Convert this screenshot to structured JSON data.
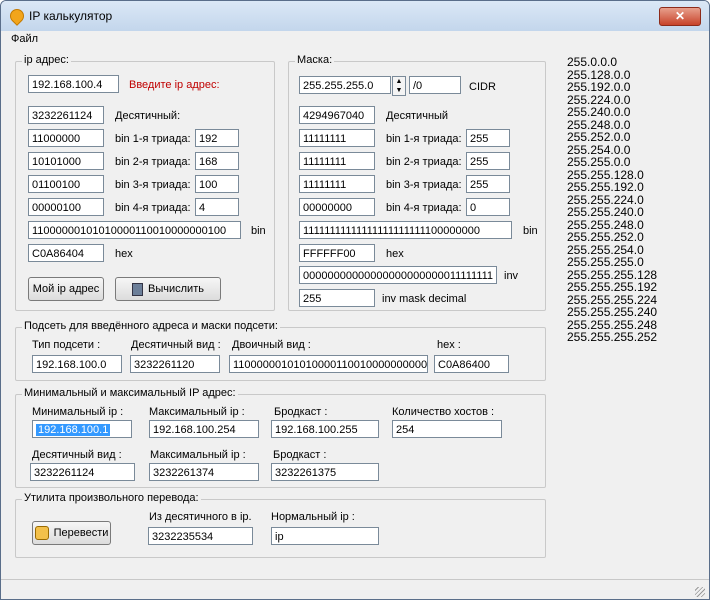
{
  "window": {
    "title": "IP калькулятор",
    "close": "✕"
  },
  "menu": {
    "file": "Файл"
  },
  "ip_group": {
    "label": "ip адрес:",
    "ip": "192.168.100.4",
    "hint": "Введите ip адрес:",
    "decimal": "3232261124",
    "decimal_label": "Десятичный:",
    "bin1": "11000000",
    "bin1_label": "bin 1-я триада:",
    "tri1": "192",
    "bin2": "10101000",
    "bin2_label": "bin 2-я триада:",
    "tri2": "168",
    "bin3": "01100100",
    "bin3_label": "bin 3-я триада:",
    "tri3": "100",
    "bin4": "00000100",
    "bin4_label": "bin 4-я триада:",
    "tri4": "4",
    "bin_full": "11000000101010000110010000000100",
    "bin_label": "bin",
    "hex": "C0A86404",
    "hex_label": "hex",
    "my_ip_button": "Мой ip адрес",
    "calc_button": "Вычислить"
  },
  "mask_group": {
    "label": "Маска:",
    "mask": "255.255.255.0",
    "cidr_value": "/0",
    "cidr_label": "CIDR",
    "decimal": "4294967040",
    "decimal_label": "Десятичный",
    "bin1": "11111111",
    "bin1_label": "bin 1-я триада:",
    "tri1": "255",
    "bin2": "11111111",
    "bin2_label": "bin 2-я триада:",
    "tri2": "255",
    "bin3": "11111111",
    "bin3_label": "bin 3-я триада:",
    "tri3": "255",
    "bin4": "00000000",
    "bin4_label": "bin 4-я триада:",
    "tri4": "0",
    "bin_full": "11111111111111111111111100000000",
    "bin_label": "bin",
    "hex": "FFFFFF00",
    "hex_label": "hex",
    "inv": "00000000000000000000000011111111",
    "inv_label": "inv",
    "inv_decimal": "255",
    "inv_decimal_label": "inv mask decimal"
  },
  "subnet_group": {
    "label": "Подсеть для введённого адреса и маски подсети:",
    "type_label": "Тип подсети :",
    "type_value": "192.168.100.0",
    "decimal_label": "Десятичный вид :",
    "decimal_value": "3232261120",
    "binary_label": "Двоичный вид :",
    "binary_value": "11000000101010000110010000000000",
    "hex_label": "hex :",
    "hex_value": "C0A86400"
  },
  "minmax_group": {
    "label": "Минимальный и максимальный IP адрес:",
    "min_label": "Минимальный  ip :",
    "min_value": "192.168.100.1",
    "max_label": "Максимальный ip :",
    "max_value": "192.168.100.254",
    "broadcast_label": "Бродкаст :",
    "broadcast_value": "192.168.100.255",
    "hosts_label": "Количество хостов :",
    "hosts_value": "254",
    "min_dec_label": "Десятичный вид :",
    "min_dec_value": "3232261124",
    "max_dec_label": "Максимальный ip :",
    "max_dec_value": "3232261374",
    "broadcast_dec_label": "Бродкаст :",
    "broadcast_dec_value": "3232261375"
  },
  "convert_group": {
    "label": "Утилита произвольного перевода:",
    "button": "Перевести",
    "from_dec_label": "Из десятичного в ip.",
    "from_dec_value": "3232235534",
    "normal_label": "Нормальный ip :",
    "normal_value": "ip"
  },
  "mask_list": [
    "255.0.0.0",
    "255.128.0.0",
    "255.192.0.0",
    "255.224.0.0",
    "255.240.0.0",
    "255.248.0.0",
    "255.252.0.0",
    "255.254.0.0",
    "255.255.0.0",
    "255.255.128.0",
    "255.255.192.0",
    "255.255.224.0",
    "255.255.240.0",
    "255.255.248.0",
    "255.255.252.0",
    "255.255.254.0",
    "255.255.255.0",
    "255.255.255.128",
    "255.255.255.192",
    "255.255.255.224",
    "255.255.255.240",
    "255.255.255.248",
    "255.255.255.252"
  ]
}
